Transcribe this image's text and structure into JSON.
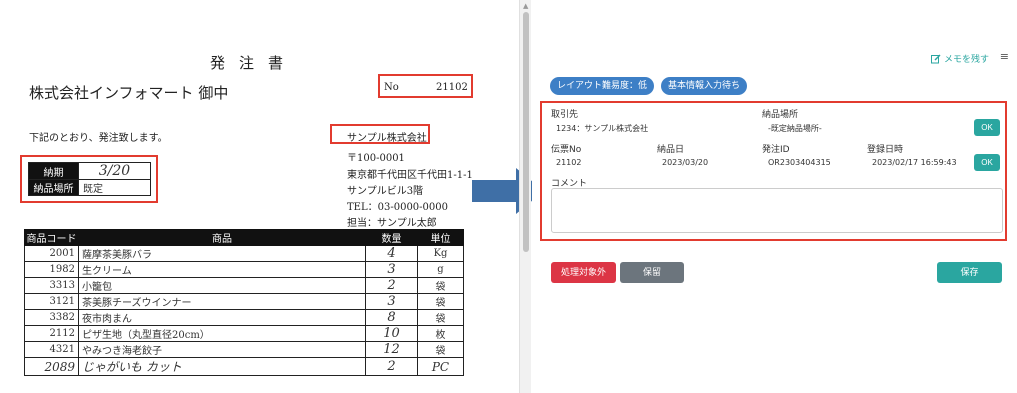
{
  "document": {
    "title": "発注書",
    "customer": "株式会社インフォマート 御中",
    "no_label": "No",
    "no_value": "21102",
    "intro": "下記のとおり、発注致します。",
    "supplier": "サンプル株式会社",
    "address_lines": [
      "〒100-0001",
      "東京都千代田区千代田1-1-1",
      "サンプルビル3階",
      "TEL：03-0000-0000",
      "担当：サンプル太郎"
    ],
    "delivery_date_label": "納期",
    "delivery_date_value": "3/20",
    "delivery_place_label": "納品場所",
    "delivery_place_value": "既定",
    "columns": [
      "商品コード",
      "商品",
      "数量",
      "単位"
    ],
    "rows": [
      {
        "code": "2001",
        "name": "薩摩茶美豚バラ",
        "qty": "4",
        "unit": "Kg"
      },
      {
        "code": "1982",
        "name": "生クリーム",
        "qty": "3",
        "unit": "g"
      },
      {
        "code": "3313",
        "name": "小籠包",
        "qty": "2",
        "unit": "袋"
      },
      {
        "code": "3121",
        "name": "茶美豚チーズウインナー",
        "qty": "3",
        "unit": "袋"
      },
      {
        "code": "3382",
        "name": "夜市肉まん",
        "qty": "8",
        "unit": "袋"
      },
      {
        "code": "2112",
        "name": "ピザ生地（丸型直径20cm）",
        "qty": "10",
        "unit": "枚"
      },
      {
        "code": "4321",
        "name": "やみつき海老餃子",
        "qty": "12",
        "unit": "袋"
      },
      {
        "code": "2089",
        "name": "じゃがいも カット",
        "qty": "2",
        "unit": "PC"
      }
    ]
  },
  "panel": {
    "memo_label": "メモを残す",
    "menu_icon": "≡",
    "badges": [
      "レイアウト難易度：低",
      "基本情報入力待ち"
    ],
    "form": {
      "partner_label": "取引先",
      "partner_value": "1234：サンプル株式会社",
      "place_label": "納品場所",
      "place_value": "-既定納品場所-",
      "ok1": "OK",
      "slip_label": "伝票No",
      "slip_value": "21102",
      "delivery_label": "納品日",
      "delivery_value": "2023/03/20",
      "order_id_label": "発注ID",
      "order_id_value": "OR2303404315",
      "registered_label": "登録日時",
      "registered_value": "2023/02/17 16:59:43",
      "ok2": "OK",
      "comment_label": "コメント",
      "comment_value": ""
    },
    "buttons": {
      "exclude": "処理対象外",
      "hold": "保留",
      "save": "保存"
    }
  },
  "colors": {
    "highlight_red": "#e23b2f",
    "teal": "#2aa6a0",
    "blue_pill": "#3d7fc6",
    "danger": "#dc3545",
    "gray": "#6c757d"
  }
}
